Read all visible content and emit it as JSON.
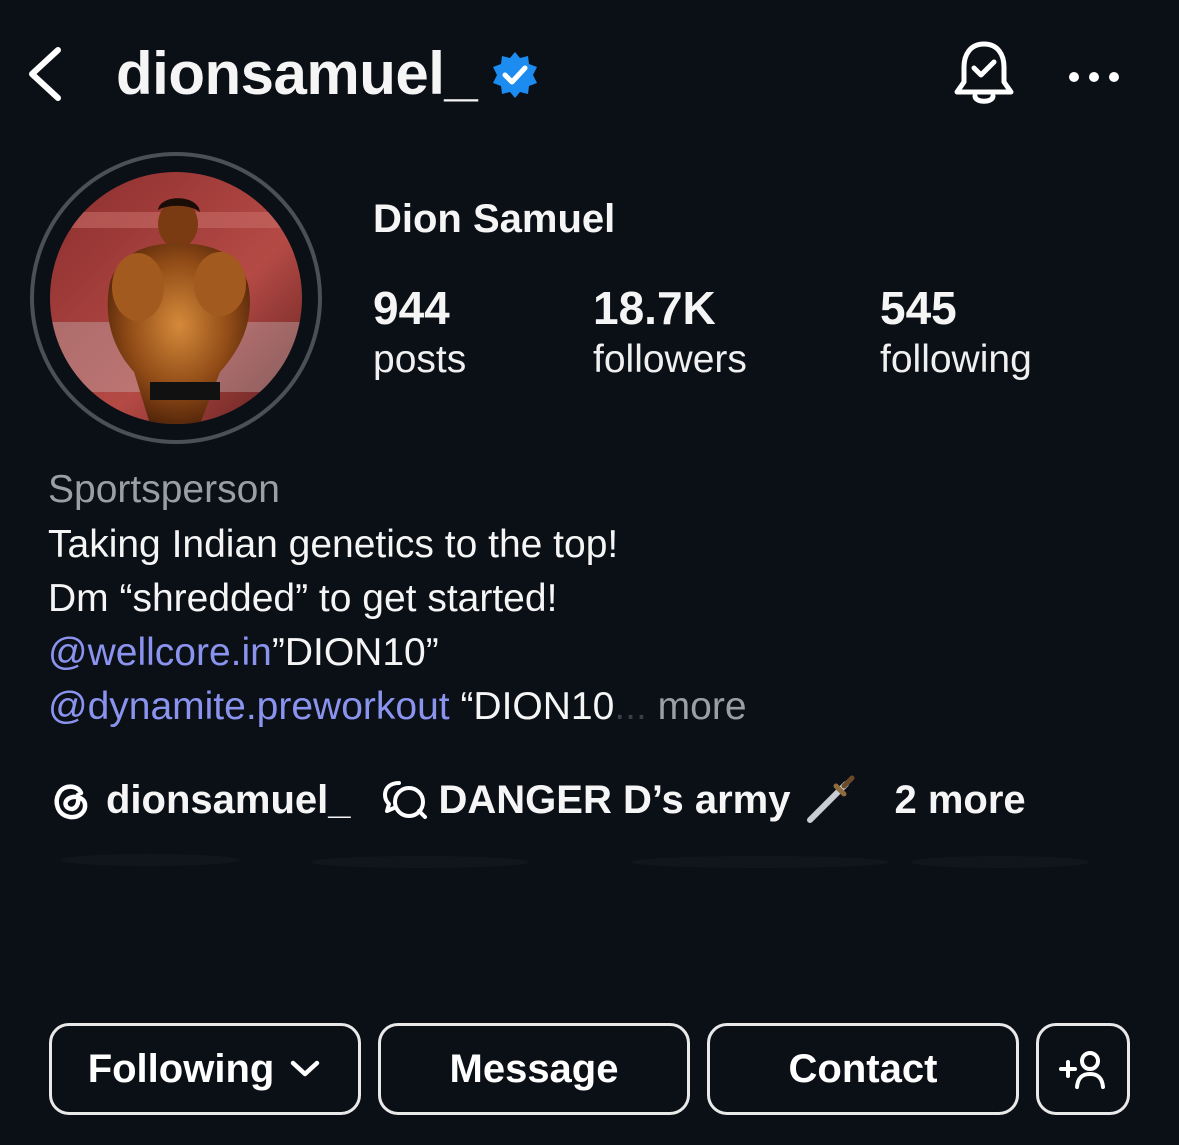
{
  "header": {
    "username": "dionsamuel_",
    "verified_icon": "verified-badge-icon",
    "back_icon": "chevron-left-icon",
    "notifications_icon": "bell-check-icon",
    "more_icon": "more-horizontal-icon"
  },
  "profile": {
    "display_name": "Dion Samuel",
    "avatar_alt": "profile-photo",
    "stats": [
      {
        "value": "944",
        "label": "posts"
      },
      {
        "value": "18.7K",
        "label": "followers"
      },
      {
        "value": "545",
        "label": "following"
      }
    ]
  },
  "bio": {
    "category": "Sportsperson",
    "line1": "Taking Indian genetics to the top!",
    "line2": "Dm “shredded” to get started!",
    "line3_mention": "@wellcore.in",
    "line3_text": "”DION10”",
    "line4_mention": "@dynamite.preworkout",
    "line4_text": " “DION10",
    "line4_ellipsis": "...",
    "more_label": " more"
  },
  "links": {
    "threads_icon": "threads-icon",
    "threads_handle": "dionsamuel_",
    "channel_icon": "chat-bubbles-icon",
    "channel_name": "DANGER D’s army",
    "channel_emoji": "🗡️",
    "more_label": "2 more"
  },
  "actions": {
    "following_label": "Following",
    "following_icon": "chevron-down-icon",
    "message_label": "Message",
    "contact_label": "Contact",
    "add_user_icon": "add-person-icon"
  },
  "colors": {
    "background": "#0b0f16",
    "verified": "#1d8cf0",
    "mention": "#8a94ef",
    "muted": "#9a9ea6"
  }
}
